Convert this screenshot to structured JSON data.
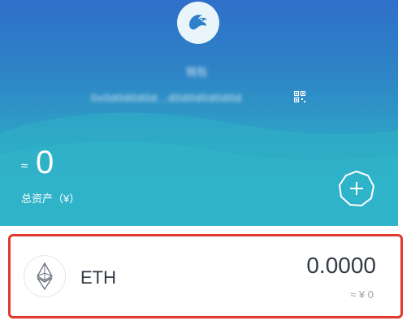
{
  "header": {
    "wallet_name": "钱包",
    "address": "0x0d0d0d0d...d0d0d0d0d0d",
    "icons": {
      "logo": "bird-logo-icon",
      "qr": "qr-code-icon"
    },
    "colors": {
      "gradient_top": "#2f6fc9",
      "gradient_bottom": "#2fb3c8"
    }
  },
  "balance": {
    "approx_symbol": "≈",
    "total_value": "0",
    "total_label": "总资产（¥）"
  },
  "actions": {
    "add_icon": "plus-icon"
  },
  "tokens": [
    {
      "symbol": "ETH",
      "icon": "ethereum-icon",
      "balance": "0.0000",
      "fiat_value": "≈ ¥ 0"
    }
  ],
  "highlight": {
    "color": "#e0392e"
  }
}
